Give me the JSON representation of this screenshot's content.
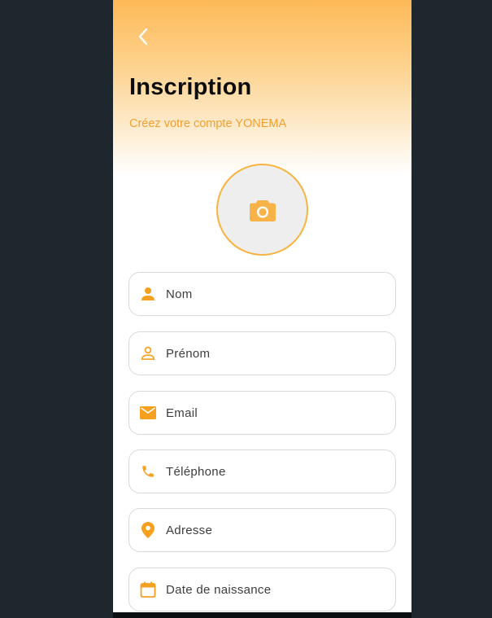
{
  "header": {
    "title": "Inscription",
    "subtitle": "Créez votre compte YONEMA"
  },
  "form": {
    "fields": [
      {
        "name": "nom",
        "icon": "person-icon",
        "placeholder": "Nom",
        "value": ""
      },
      {
        "name": "prenom",
        "icon": "person-outline-icon",
        "placeholder": "Prénom",
        "value": ""
      },
      {
        "name": "email",
        "icon": "mail-icon",
        "placeholder": "Email",
        "value": ""
      },
      {
        "name": "telephone",
        "icon": "phone-icon",
        "placeholder": "Téléphone",
        "value": ""
      },
      {
        "name": "adresse",
        "icon": "location-pin-icon",
        "placeholder": "Adresse",
        "value": ""
      },
      {
        "name": "date-naissance",
        "icon": "calendar-icon",
        "placeholder": "Date de naissance",
        "value": ""
      }
    ]
  },
  "avatar": {
    "icon": "camera-icon"
  },
  "colors": {
    "accent": "#f5a623",
    "gradient_top": "#fdb957",
    "background_outer": "#1f272e",
    "title": "#0d0d0d",
    "subtitle": "#f0a030"
  }
}
